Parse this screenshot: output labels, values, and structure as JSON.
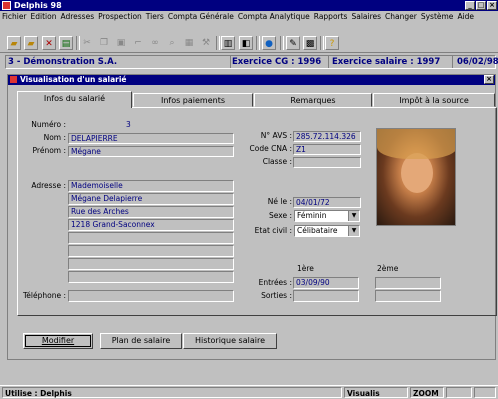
{
  "app": {
    "title": "Delphis 98"
  },
  "menu": [
    "Fichier",
    "Edition",
    "Adresses",
    "Prospection",
    "Tiers",
    "Compta Générale",
    "Compta Analytique",
    "Rapports",
    "Salaires",
    "Changer",
    "Système",
    "Aide"
  ],
  "toolbar": {
    "icons": [
      "open-folder-icon",
      "folder-icon",
      "cut-icon",
      "paste-icon",
      "scissors-icon",
      "copy-icon",
      "print-icon",
      "find-icon",
      "binoculars-icon",
      "table-icon",
      "wrench-icon",
      "calculator-icon",
      "globe-icon",
      "edit-icon",
      "print-icon",
      "help-icon"
    ]
  },
  "infobar": {
    "company": "3 - Démonstration S.A.",
    "exercice_cg": "Exercice CG : 1996",
    "exercice_salaire": "Exercice salaire :   1997",
    "date": "06/02/98"
  },
  "window": {
    "title": "Visualisation d'un salarié",
    "close": "×"
  },
  "tabs": [
    "Infos du salarié",
    "Infos paiements",
    "Remarques",
    "Impôt à la source"
  ],
  "form": {
    "numero_label": "Numéro :",
    "numero": "3",
    "nom_label": "Nom :",
    "nom": "DELAPIERRE",
    "prenom_label": "Prénom :",
    "prenom": "Mégane",
    "adresse_label": "Adresse :",
    "adresse": [
      "Mademoiselle",
      "Mégane Delapierre",
      "Rue des Arches",
      "1218 Grand-Saconnex",
      "",
      "",
      "",
      ""
    ],
    "telephone_label": "Téléphone :",
    "avs_label": "N° AVS :",
    "avs": "285.72.114.326",
    "cna_label": "Code CNA :",
    "cna": "Z1",
    "classe_label": "Classe :",
    "ne_label": "Né le :",
    "ne": "04/01/72",
    "sexe_label": "Sexe :",
    "sexe": "Féminin",
    "etat_label": "Etat civil :",
    "etat": "Célibataire",
    "col1": "1ère",
    "col2": "2ème",
    "entrees_label": "Entrées :",
    "entrees": "03/09/90",
    "sorties_label": "Sorties :"
  },
  "buttons": {
    "modifier": "Modifier",
    "plan": "Plan de salaire",
    "historique": "Historique salaire"
  },
  "status": {
    "user": "Utilise : Delphis",
    "mode": "Visualis",
    "zoom": "ZOOM"
  }
}
